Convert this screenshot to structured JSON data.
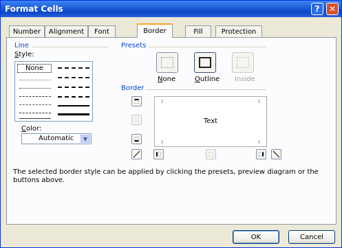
{
  "window": {
    "title": "Format Cells",
    "help_glyph": "?",
    "close_glyph": "✕"
  },
  "tabs": [
    "Number",
    "Alignment",
    "Font",
    "Border",
    "Fill",
    "Protection"
  ],
  "active_tab": "Border",
  "line_group": {
    "title": "Line",
    "style_label_u": "S",
    "style_label_rest": "tyle:",
    "none_item": "None",
    "color_label_u": "C",
    "color_label_rest": "olor:",
    "color_value": "Automatic",
    "dropdown_glyph": "▼"
  },
  "presets": {
    "title": "Presets",
    "items": [
      {
        "u": "N",
        "rest": "one"
      },
      {
        "u": "O",
        "rest": "utline"
      },
      {
        "u": "",
        "rest": "Inside"
      }
    ]
  },
  "border_group": {
    "title": "Border",
    "preview_text": "Text"
  },
  "description": "The selected border style can be applied by clicking the presets, preview diagram or the buttons above.",
  "buttons": {
    "ok": "OK",
    "cancel": "Cancel"
  },
  "colors": {
    "title_bar": "#0a46c8",
    "dialog_bg": "#ece9d8",
    "group_label": "#0046d5",
    "tab_highlight": "#f7a928"
  }
}
